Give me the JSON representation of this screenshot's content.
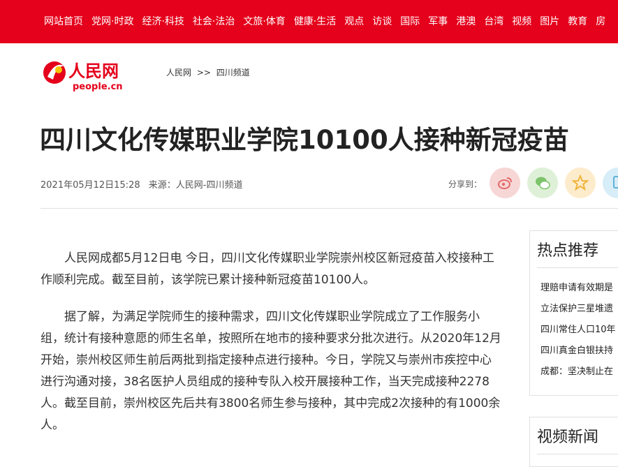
{
  "topnav": [
    "网站首页",
    "党网·时政",
    "经济·科技",
    "社会·法治",
    "文旅·体育",
    "健康·生活",
    "观点",
    "访谈",
    "国际",
    "军事",
    "港澳",
    "台湾",
    "视频",
    "图片",
    "教育",
    "房"
  ],
  "logo": {
    "cn": "人民网",
    "en": "people.cn"
  },
  "breadcrumb": {
    "home": "人民网",
    "sep": ">>",
    "channel": "四川频道"
  },
  "article": {
    "title": "四川文化传媒职业学院10100人接种新冠疫苗",
    "datetime": "2021年05月12日15:28",
    "source": "来源：人民网-四川频道",
    "share_label": "分享到：",
    "paragraphs": [
      "人民网成都5月12日电 今日，四川文化传媒职业学院崇州校区新冠疫苗入校接种工作顺利完成。截至目前，该学院已累计接种新冠疫苗10100人。",
      "据了解，为满足学院师生的接种需求，四川文化传媒职业学院成立了工作服务小组，统计有接种意愿的师生名单，按照所在地市的接种要求分批次进行。从2020年12月开始，崇州校区师生前后两批到指定接种点进行接种。今日，学院又与崇州市疾控中心进行沟通对接，38名医护人员组成的接种专队入校开展接种工作，当天完成接种2278人。截至目前，崇州校区先后共有3800名师生参与接种，其中完成2次接种的有1000余人。"
    ]
  },
  "share_icons": [
    {
      "name": "weibo-share-icon",
      "color": "#f7d6d6",
      "fg": "#e46a6a"
    },
    {
      "name": "wechat-share-icon",
      "color": "#dff0d8",
      "fg": "#7cc36b"
    },
    {
      "name": "qzone-share-icon",
      "color": "#fdeccc",
      "fg": "#f0b43c"
    },
    {
      "name": "copy-share-icon",
      "color": "#d7edf7",
      "fg": "#5fb2d9"
    }
  ],
  "sidebar": {
    "hot_title": "热点推荐",
    "hot_items": [
      "理赔申请有效期是",
      "立法保护三星堆遗",
      "四川常住人口10年",
      "四川真金白银扶持",
      "成都：坚决制止在"
    ],
    "video_title": "视频新闻"
  },
  "colors": {
    "brand_red": "#e5001b"
  }
}
